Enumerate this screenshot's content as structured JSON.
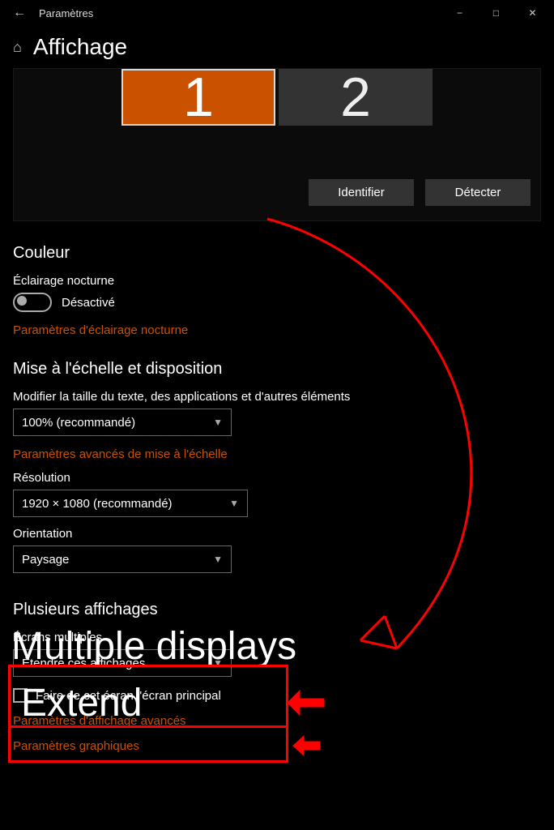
{
  "window": {
    "app_title": "Paramètres"
  },
  "page": {
    "title": "Affichage"
  },
  "monitors": {
    "m1": "1",
    "m2": "2",
    "identify": "Identifier",
    "detect": "Détecter"
  },
  "color": {
    "section": "Couleur",
    "nightlight_label": "Éclairage nocturne",
    "nightlight_state": "Désactivé",
    "nightlight_link": "Paramètres d'éclairage nocturne"
  },
  "scale": {
    "section": "Mise à l'échelle et disposition",
    "size_label": "Modifier la taille du texte, des applications et d'autres éléments",
    "size_value": "100% (recommandé)",
    "adv_link": "Paramètres avancés de mise à l'échelle",
    "res_label": "Résolution",
    "res_value": "1920 × 1080 (recommandé)",
    "orient_label": "Orientation",
    "orient_value": "Paysage"
  },
  "multi": {
    "section": "Plusieurs affichages",
    "md_label": "Écrans multiples",
    "md_value": "Étendre ces affichages",
    "primary_checkbox": "Faire de cet écran l'écran principal",
    "adv_link": "Paramètres d'affichage avancés",
    "gfx_link": "Paramètres graphiques"
  },
  "annotations": {
    "multiple_displays": "Multiple displays",
    "extend": "Extend"
  }
}
